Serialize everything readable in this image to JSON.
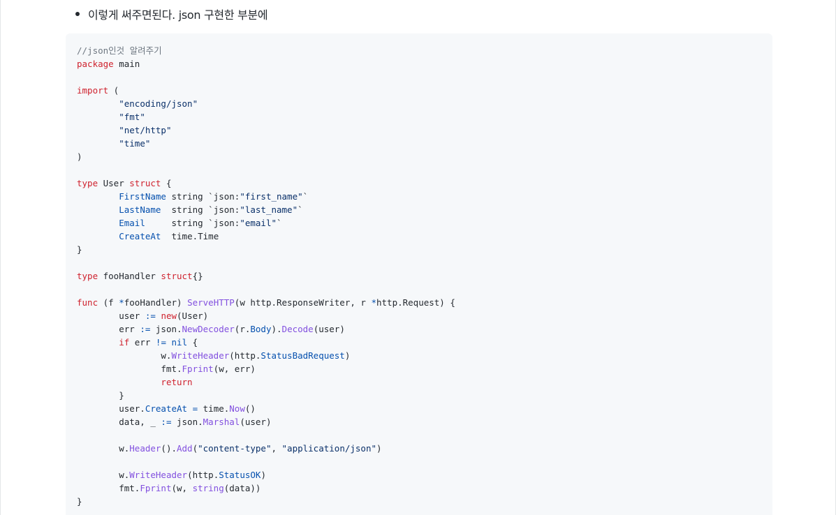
{
  "bullet": {
    "text": "이렇게 써주면된다. json 구현한 부분에"
  },
  "code": {
    "language": "go",
    "colors": {
      "kw": "#cf222e",
      "fn": "#8250df",
      "id": "#0550ae",
      "cm": "#6e7781",
      "str": "#0a3069",
      "plain": "#24292f"
    },
    "lines": [
      [
        {
          "t": "cm",
          "v": "//json인것 알려주기"
        }
      ],
      [
        {
          "t": "kw",
          "v": "package"
        },
        {
          "t": "plain",
          "v": " main"
        }
      ],
      [],
      [
        {
          "t": "kw",
          "v": "import"
        },
        {
          "t": "plain",
          "v": " ("
        }
      ],
      [
        {
          "t": "plain",
          "v": "        "
        },
        {
          "t": "str",
          "v": "\"encoding/json\""
        }
      ],
      [
        {
          "t": "plain",
          "v": "        "
        },
        {
          "t": "str",
          "v": "\"fmt\""
        }
      ],
      [
        {
          "t": "plain",
          "v": "        "
        },
        {
          "t": "str",
          "v": "\"net/http\""
        }
      ],
      [
        {
          "t": "plain",
          "v": "        "
        },
        {
          "t": "str",
          "v": "\"time\""
        }
      ],
      [
        {
          "t": "plain",
          "v": ")"
        }
      ],
      [],
      [
        {
          "t": "kw",
          "v": "type"
        },
        {
          "t": "plain",
          "v": " User "
        },
        {
          "t": "kw",
          "v": "struct"
        },
        {
          "t": "plain",
          "v": " {"
        }
      ],
      [
        {
          "t": "plain",
          "v": "        "
        },
        {
          "t": "id",
          "v": "FirstName"
        },
        {
          "t": "plain",
          "v": " string `json:"
        },
        {
          "t": "str",
          "v": "\"first_name\""
        },
        {
          "t": "plain",
          "v": "`"
        }
      ],
      [
        {
          "t": "plain",
          "v": "        "
        },
        {
          "t": "id",
          "v": "LastName"
        },
        {
          "t": "plain",
          "v": "  string `json:"
        },
        {
          "t": "str",
          "v": "\"last_name\""
        },
        {
          "t": "plain",
          "v": "`"
        }
      ],
      [
        {
          "t": "plain",
          "v": "        "
        },
        {
          "t": "id",
          "v": "Email"
        },
        {
          "t": "plain",
          "v": "     string `json:"
        },
        {
          "t": "str",
          "v": "\"email\""
        },
        {
          "t": "plain",
          "v": "`"
        }
      ],
      [
        {
          "t": "plain",
          "v": "        "
        },
        {
          "t": "id",
          "v": "CreateAt"
        },
        {
          "t": "plain",
          "v": "  time.Time"
        }
      ],
      [
        {
          "t": "plain",
          "v": "}"
        }
      ],
      [],
      [
        {
          "t": "kw",
          "v": "type"
        },
        {
          "t": "plain",
          "v": " fooHandler "
        },
        {
          "t": "kw",
          "v": "struct"
        },
        {
          "t": "plain",
          "v": "{}"
        }
      ],
      [],
      [
        {
          "t": "kw",
          "v": "func"
        },
        {
          "t": "plain",
          "v": " (f "
        },
        {
          "t": "id",
          "v": "*"
        },
        {
          "t": "plain",
          "v": "fooHandler) "
        },
        {
          "t": "fn",
          "v": "ServeHTTP"
        },
        {
          "t": "plain",
          "v": "(w http.ResponseWriter, r "
        },
        {
          "t": "id",
          "v": "*"
        },
        {
          "t": "plain",
          "v": "http.Request) {"
        }
      ],
      [
        {
          "t": "plain",
          "v": "        user "
        },
        {
          "t": "id",
          "v": ":="
        },
        {
          "t": "plain",
          "v": " "
        },
        {
          "t": "kw",
          "v": "new"
        },
        {
          "t": "plain",
          "v": "(User)"
        }
      ],
      [
        {
          "t": "plain",
          "v": "        err "
        },
        {
          "t": "id",
          "v": ":="
        },
        {
          "t": "plain",
          "v": " json."
        },
        {
          "t": "fn",
          "v": "NewDecoder"
        },
        {
          "t": "plain",
          "v": "(r."
        },
        {
          "t": "id",
          "v": "Body"
        },
        {
          "t": "plain",
          "v": ")."
        },
        {
          "t": "fn",
          "v": "Decode"
        },
        {
          "t": "plain",
          "v": "(user)"
        }
      ],
      [
        {
          "t": "plain",
          "v": "        "
        },
        {
          "t": "kw",
          "v": "if"
        },
        {
          "t": "plain",
          "v": " err "
        },
        {
          "t": "id",
          "v": "!="
        },
        {
          "t": "plain",
          "v": " "
        },
        {
          "t": "id",
          "v": "nil"
        },
        {
          "t": "plain",
          "v": " {"
        }
      ],
      [
        {
          "t": "plain",
          "v": "                w."
        },
        {
          "t": "fn",
          "v": "WriteHeader"
        },
        {
          "t": "plain",
          "v": "(http."
        },
        {
          "t": "id",
          "v": "StatusBadRequest"
        },
        {
          "t": "plain",
          "v": ")"
        }
      ],
      [
        {
          "t": "plain",
          "v": "                fmt."
        },
        {
          "t": "fn",
          "v": "Fprint"
        },
        {
          "t": "plain",
          "v": "(w, err)"
        }
      ],
      [
        {
          "t": "plain",
          "v": "                "
        },
        {
          "t": "kw",
          "v": "return"
        }
      ],
      [
        {
          "t": "plain",
          "v": "        }"
        }
      ],
      [
        {
          "t": "plain",
          "v": "        user."
        },
        {
          "t": "id",
          "v": "CreateAt"
        },
        {
          "t": "plain",
          "v": " "
        },
        {
          "t": "id",
          "v": "="
        },
        {
          "t": "plain",
          "v": " time."
        },
        {
          "t": "fn",
          "v": "Now"
        },
        {
          "t": "plain",
          "v": "()"
        }
      ],
      [
        {
          "t": "plain",
          "v": "        data, _ "
        },
        {
          "t": "id",
          "v": ":="
        },
        {
          "t": "plain",
          "v": " json."
        },
        {
          "t": "fn",
          "v": "Marshal"
        },
        {
          "t": "plain",
          "v": "(user)"
        }
      ],
      [],
      [
        {
          "t": "plain",
          "v": "        w."
        },
        {
          "t": "fn",
          "v": "Header"
        },
        {
          "t": "plain",
          "v": "()."
        },
        {
          "t": "fn",
          "v": "Add"
        },
        {
          "t": "plain",
          "v": "("
        },
        {
          "t": "str",
          "v": "\"content-type\""
        },
        {
          "t": "plain",
          "v": ", "
        },
        {
          "t": "str",
          "v": "\"application/json\""
        },
        {
          "t": "plain",
          "v": ")"
        }
      ],
      [],
      [
        {
          "t": "plain",
          "v": "        w."
        },
        {
          "t": "fn",
          "v": "WriteHeader"
        },
        {
          "t": "plain",
          "v": "(http."
        },
        {
          "t": "id",
          "v": "StatusOK"
        },
        {
          "t": "plain",
          "v": ")"
        }
      ],
      [
        {
          "t": "plain",
          "v": "        fmt."
        },
        {
          "t": "fn",
          "v": "Fprint"
        },
        {
          "t": "plain",
          "v": "(w, "
        },
        {
          "t": "fn",
          "v": "string"
        },
        {
          "t": "plain",
          "v": "(data))"
        }
      ],
      [
        {
          "t": "plain",
          "v": "}"
        }
      ]
    ]
  }
}
